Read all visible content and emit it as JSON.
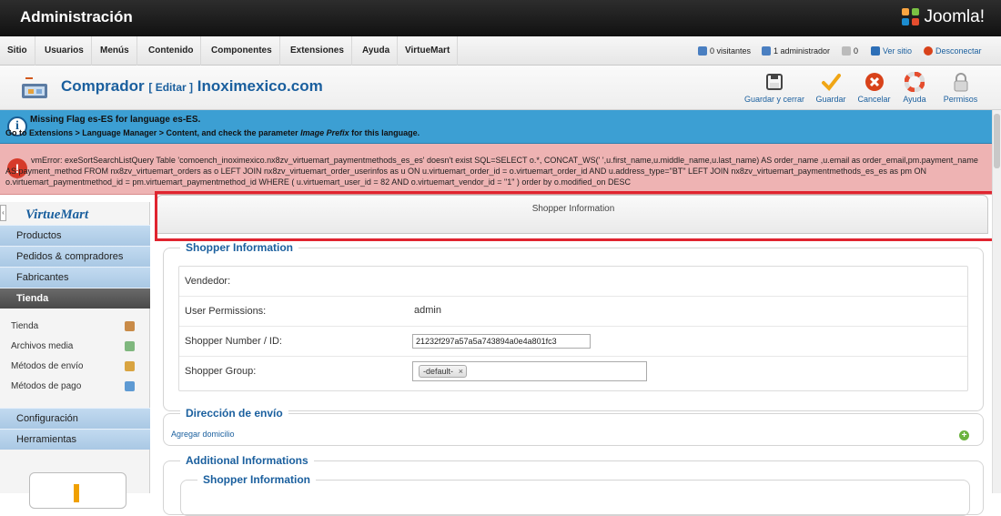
{
  "header": {
    "title": "Administración",
    "brand": "Joomla!"
  },
  "menu": [
    "Sitio",
    "Usuarios",
    "Menús",
    "Contenido",
    "Componentes",
    "Extensiones",
    "Ayuda",
    "VirtueMart"
  ],
  "status": {
    "visitors": "0 visitantes",
    "admins": "1 administrador",
    "messages": "0",
    "view_site": "Ver sitio",
    "logout": "Desconectar"
  },
  "toolbar": {
    "title": "Comprador",
    "edit": "[ Editar ]",
    "site": "Inoximexico.com",
    "buttons": [
      "Guardar y cerrar",
      "Guardar",
      "Cancelar",
      "Ayuda",
      "Permisos"
    ]
  },
  "info_message": {
    "line1": "Missing Flag es-ES for language es-ES.",
    "line2_a": "Go to Extensions > Language Manager > Content, and check the parameter ",
    "line2_em": "Image Prefix",
    "line2_b": " for this language."
  },
  "error_message": "vmError: exeSortSearchListQuery Table 'comoench_inoximexico.nx8zv_virtuemart_paymentmethods_es_es' doesn't exist SQL=SELECT o.*, CONCAT_WS(' ',u.first_name,u.middle_name,u.last_name) AS order_name ,u.email as order_email,pm.payment_name AS payment_method FROM nx8zv_virtuemart_orders as o LEFT JOIN nx8zv_virtuemart_order_userinfos as u ON u.virtuemart_order_id = o.virtuemart_order_id AND u.address_type=\"BT\" LEFT JOIN nx8zv_virtuemart_paymentmethods_es_es as pm ON o.virtuemart_paymentmethod_id = pm.virtuemart_paymentmethod_id WHERE ( u.virtuemart_user_id = 82 AND o.virtuemart_vendor_id = \"1\" ) order by o.modified_on DESC",
  "sidebar": {
    "logo": "VirtueMart",
    "items": [
      "Productos",
      "Pedidos & compradores",
      "Fabricantes",
      "Tienda"
    ],
    "sub_items": [
      "Tienda",
      "Archivos media",
      "Métodos de envío",
      "Métodos de pago"
    ],
    "bottom_items": [
      "Configuración",
      "Herramientas"
    ]
  },
  "main": {
    "tab_title": "Shopper Information",
    "shopper_section": "Shopper Information",
    "fields": {
      "vendor_label": "Vendedor:",
      "permissions_label": "User Permissions:",
      "permissions_value": "admin",
      "number_label": "Shopper Number / ID:",
      "number_value": "21232f297a57a5a743894a0e4a801fc3",
      "group_label": "Shopper Group:",
      "group_value": "-default-",
      "group_remove": "×"
    },
    "shipping_section": "Dirección de envío",
    "add_address": "Agregar domicilio",
    "additional_section": "Additional Informations",
    "additional_sub_section": "Shopper Information"
  },
  "colors": {
    "accent": "#1a5f9e",
    "highlight": "#e0242f",
    "info": "#3c9fd3",
    "error": "#eeb3b3"
  }
}
